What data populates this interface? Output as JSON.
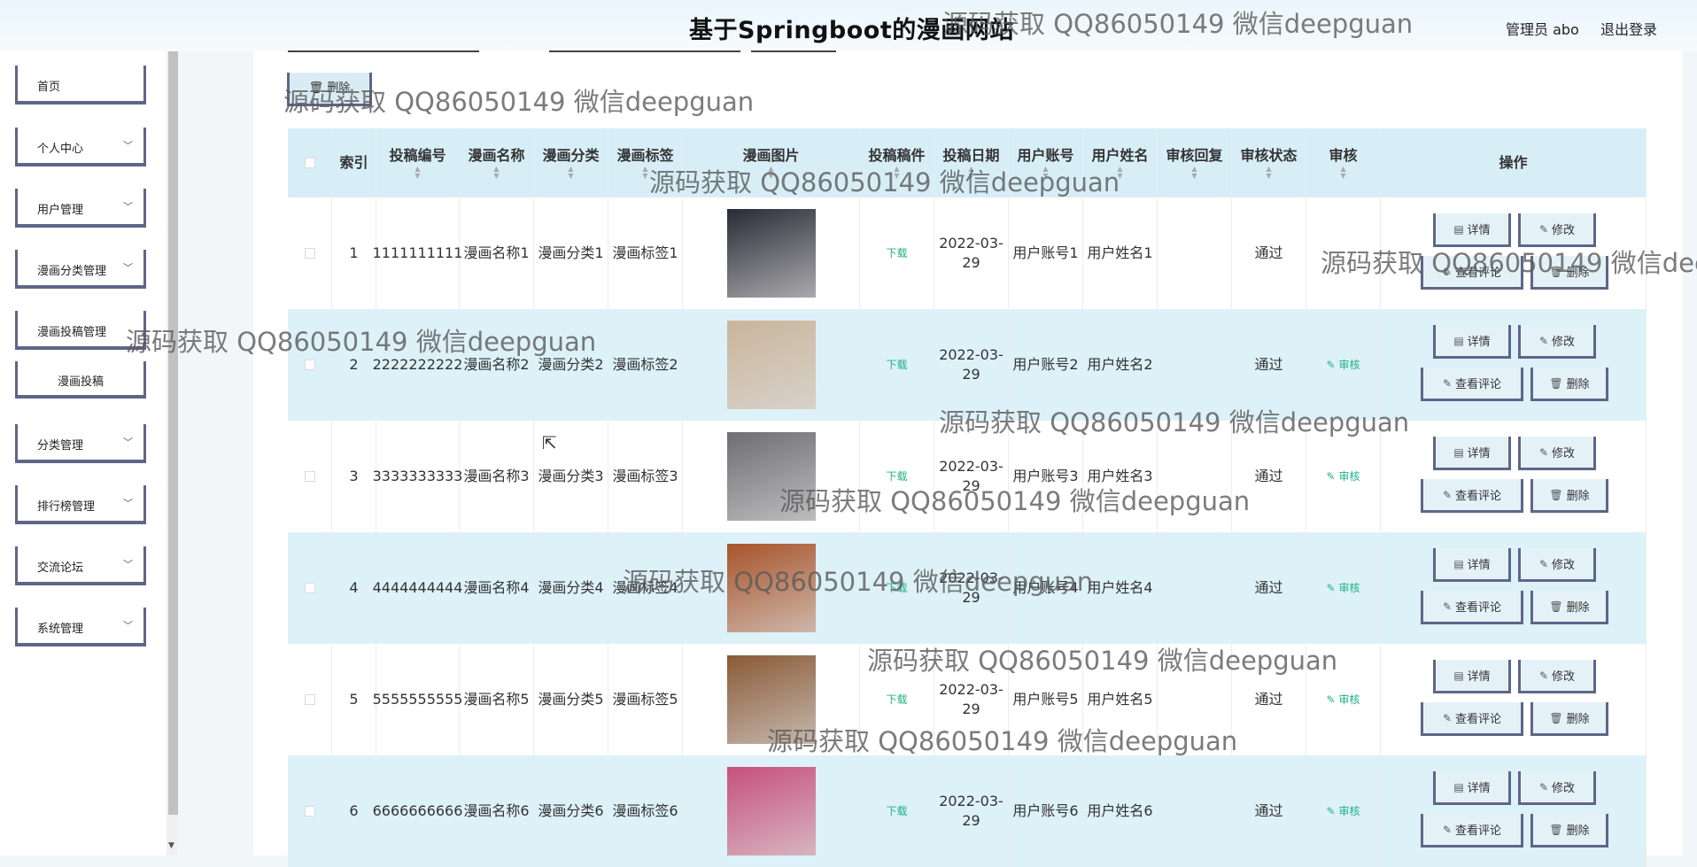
{
  "header": {
    "title": "基于Springboot的漫画网站",
    "user": "管理员 abo",
    "logout": "退出登录"
  },
  "sidebar": {
    "items": [
      {
        "label": "首页",
        "has_children": false
      },
      {
        "label": "个人中心",
        "has_children": true
      },
      {
        "label": "用户管理",
        "has_children": true
      },
      {
        "label": "漫画分类管理",
        "has_children": true
      },
      {
        "label": "漫画投稿管理",
        "has_children": false
      }
    ],
    "sub_item": "漫画投稿",
    "items_after": [
      {
        "label": "分类管理",
        "has_children": true
      },
      {
        "label": "排行榜管理",
        "has_children": true
      },
      {
        "label": "交流论坛",
        "has_children": true
      },
      {
        "label": "系统管理",
        "has_children": true
      }
    ]
  },
  "toolbar": {
    "delete_label": "删除",
    "delete_icon": "trash-icon"
  },
  "table": {
    "columns": [
      "索引",
      "投稿编号",
      "漫画名称",
      "漫画分类",
      "漫画标签",
      "漫画图片",
      "投稿稿件",
      "投稿日期",
      "用户账号",
      "用户姓名",
      "审核回复",
      "审核状态",
      "审核",
      "操作"
    ],
    "download_label": "下载",
    "audit_label": "审核",
    "actions": {
      "detail": "详情",
      "edit": "修改",
      "comments": "查看评论",
      "delete": "删除"
    },
    "rows": [
      {
        "index": "1",
        "code": "1111111111",
        "name": "漫画名称1",
        "category": "漫画分类1",
        "tag": "漫画标签1",
        "date": "2022-03-29",
        "account": "用户账号1",
        "username": "用户姓名1",
        "reply": "",
        "status": "通过",
        "cover": "#2a2a36"
      },
      {
        "index": "2",
        "code": "2222222222",
        "name": "漫画名称2",
        "category": "漫画分类2",
        "tag": "漫画标签2",
        "date": "2022-03-29",
        "account": "用户账号2",
        "username": "用户姓名2",
        "reply": "",
        "status": "通过",
        "cover": "#c9b59a"
      },
      {
        "index": "3",
        "code": "3333333333",
        "name": "漫画名称3",
        "category": "漫画分类3",
        "tag": "漫画标签3",
        "date": "2022-03-29",
        "account": "用户账号3",
        "username": "用户姓名3",
        "reply": "",
        "status": "通过",
        "cover": "#6e6e72"
      },
      {
        "index": "4",
        "code": "4444444444",
        "name": "漫画名称4",
        "category": "漫画分类4",
        "tag": "漫画标签4",
        "date": "2022-03-29",
        "account": "用户账号4",
        "username": "用户姓名4",
        "reply": "",
        "status": "通过",
        "cover": "#a8542a"
      },
      {
        "index": "5",
        "code": "5555555555",
        "name": "漫画名称5",
        "category": "漫画分类5",
        "tag": "漫画标签5",
        "date": "2022-03-29",
        "account": "用户账号5",
        "username": "用户姓名5",
        "reply": "",
        "status": "通过",
        "cover": "#8a5a36"
      },
      {
        "index": "6",
        "code": "6666666666",
        "name": "漫画名称6",
        "category": "漫画分类6",
        "tag": "漫画标签6",
        "date": "2022-03-29",
        "account": "用户账号6",
        "username": "用户姓名6",
        "reply": "",
        "status": "通过",
        "cover": "#c7507a"
      }
    ]
  },
  "watermark": "源码获取 QQ86050149 微信deepguan"
}
